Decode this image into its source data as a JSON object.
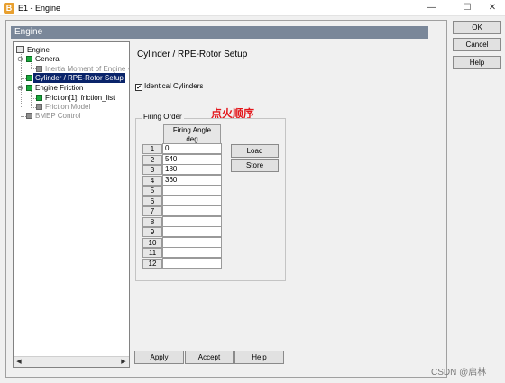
{
  "window": {
    "app_icon_letter": "B",
    "title": "E1 - Engine",
    "controls": {
      "minimize": "—",
      "maximize": "☐",
      "close": "✕"
    }
  },
  "section_header": "Engine",
  "tree": {
    "root": "Engine",
    "general": "General",
    "inertia": "Inertia Moment of Engine -",
    "cylinder": "Cylinder / RPE-Rotor Setup",
    "engine_friction": "Engine Friction",
    "friction_item": "Friction[1]: friction_list",
    "friction_model": "Friction Model",
    "bmep": "BMEP Control",
    "collapse_glyph": "⊖",
    "scroll_left": "◀",
    "scroll_right": "▶"
  },
  "panel": {
    "title": "Cylinder / RPE-Rotor Setup",
    "identical_label": "Identical Cylinders",
    "identical_checked": "✔",
    "group_label": "Firing Order",
    "annotation": "点火顺序",
    "col_header": "Firing Angle",
    "col_unit": "deg",
    "rows": [
      {
        "n": "1",
        "v": "0"
      },
      {
        "n": "2",
        "v": "540"
      },
      {
        "n": "3",
        "v": "180"
      },
      {
        "n": "4",
        "v": "360"
      },
      {
        "n": "5",
        "v": ""
      },
      {
        "n": "6",
        "v": ""
      },
      {
        "n": "7",
        "v": ""
      },
      {
        "n": "8",
        "v": ""
      },
      {
        "n": "9",
        "v": ""
      },
      {
        "n": "10",
        "v": ""
      },
      {
        "n": "11",
        "v": ""
      },
      {
        "n": "12",
        "v": ""
      }
    ],
    "load": "Load",
    "store": "Store"
  },
  "bottom_buttons": {
    "apply": "Apply",
    "accept": "Accept",
    "help": "Help"
  },
  "side_buttons": {
    "ok": "OK",
    "cancel": "Cancel",
    "help": "Help"
  },
  "watermark": "CSDN @启林"
}
